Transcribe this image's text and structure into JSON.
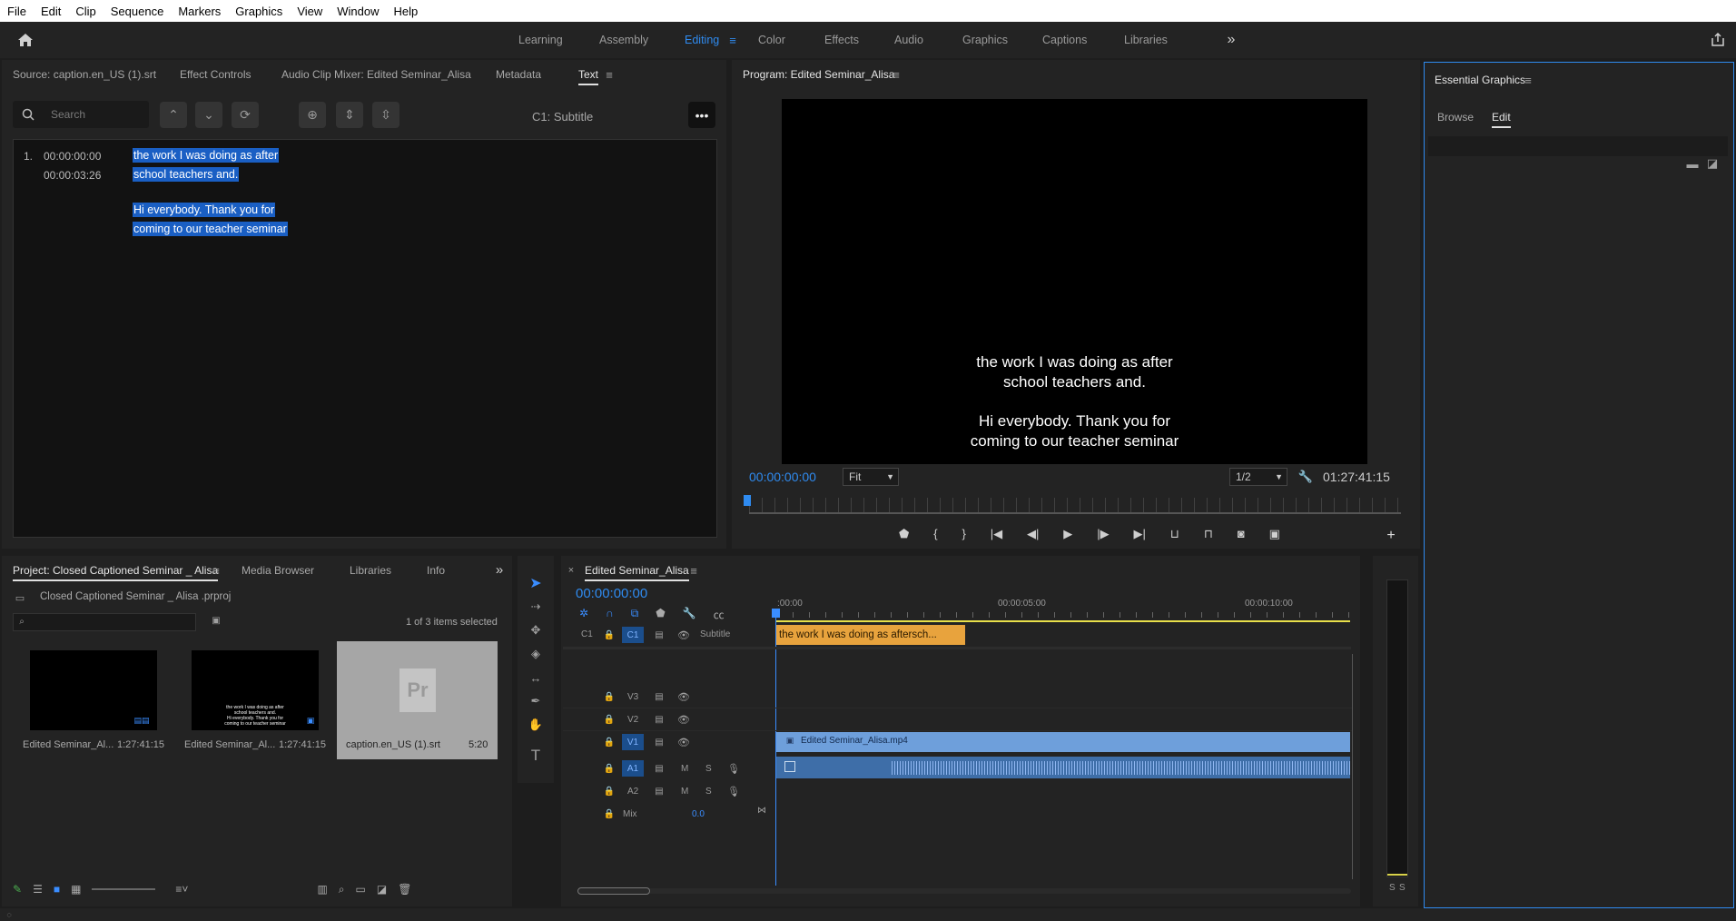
{
  "menu": [
    "File",
    "Edit",
    "Clip",
    "Sequence",
    "Markers",
    "Graphics",
    "View",
    "Window",
    "Help"
  ],
  "workspaces": [
    "Learning",
    "Assembly",
    "Editing",
    "Color",
    "Effects",
    "Audio",
    "Graphics",
    "Captions",
    "Libraries"
  ],
  "active_workspace": "Editing",
  "source_panel": {
    "tabs": [
      "Source: caption.en_US (1).srt",
      "Effect Controls",
      "Audio Clip Mixer: Edited Seminar_Alisa",
      "Metadata",
      "Text"
    ],
    "search_placeholder": "Search",
    "track_label": "C1: Subtitle",
    "caption": {
      "index": "1.",
      "in": "00:00:00:00",
      "out": "00:00:03:26",
      "lines": [
        "the work I was doing as after",
        "school teachers and.",
        "Hi everybody. Thank you for",
        "coming to our teacher seminar"
      ]
    }
  },
  "program": {
    "title": "Program: Edited Seminar_Alisa",
    "caption_lines": [
      "the work I was doing as after",
      "school teachers and.",
      "Hi everybody. Thank you for",
      "coming to our teacher seminar"
    ],
    "timecode": "00:00:00:00",
    "fit": "Fit",
    "resolution": "1/2",
    "duration": "01:27:41:15"
  },
  "essential_graphics": {
    "title": "Essential Graphics",
    "tabs": [
      "Browse",
      "Edit"
    ]
  },
  "project": {
    "tabs": [
      "Project: Closed Captioned Seminar _ Alisa",
      "Media Browser",
      "Libraries",
      "Info"
    ],
    "file": "Closed Captioned Seminar _ Alisa .prproj",
    "selection": "1 of 3 items selected",
    "items": [
      {
        "name": "Edited Seminar_Al...",
        "duration": "1:27:41:15"
      },
      {
        "name": "Edited Seminar_Al...",
        "duration": "1:27:41:15"
      },
      {
        "name": "caption.en_US (1).srt",
        "duration": "5:20"
      }
    ],
    "thumb2_lines": [
      "the work I was doing as after",
      "school teachers and.",
      "Hi everybody. Thank you for",
      "coming to our teacher seminar"
    ]
  },
  "timeline": {
    "title": "Edited Seminar_Alisa",
    "timecode": "00:00:00:00",
    "ruler": [
      ":00:00",
      "00:00:05:00",
      "00:00:10:00"
    ],
    "caption_track": {
      "label": "C1",
      "name": "Subtitle",
      "clip": "the work I was doing as aftersch..."
    },
    "video_tracks": [
      "V3",
      "V2",
      "V1"
    ],
    "video_clip": "Edited Seminar_Alisa.mp4",
    "audio_tracks": [
      "A1",
      "A2"
    ],
    "mix_label": "Mix",
    "mix_value": "0.0",
    "mute": "M",
    "solo": "S",
    "meter_labels": [
      "S",
      "S"
    ]
  },
  "tool_text": "T",
  "colors": {
    "accent": "#2f8bf0",
    "caption_clip": "#e8a33d",
    "video_clip": "#6e9fdb"
  }
}
